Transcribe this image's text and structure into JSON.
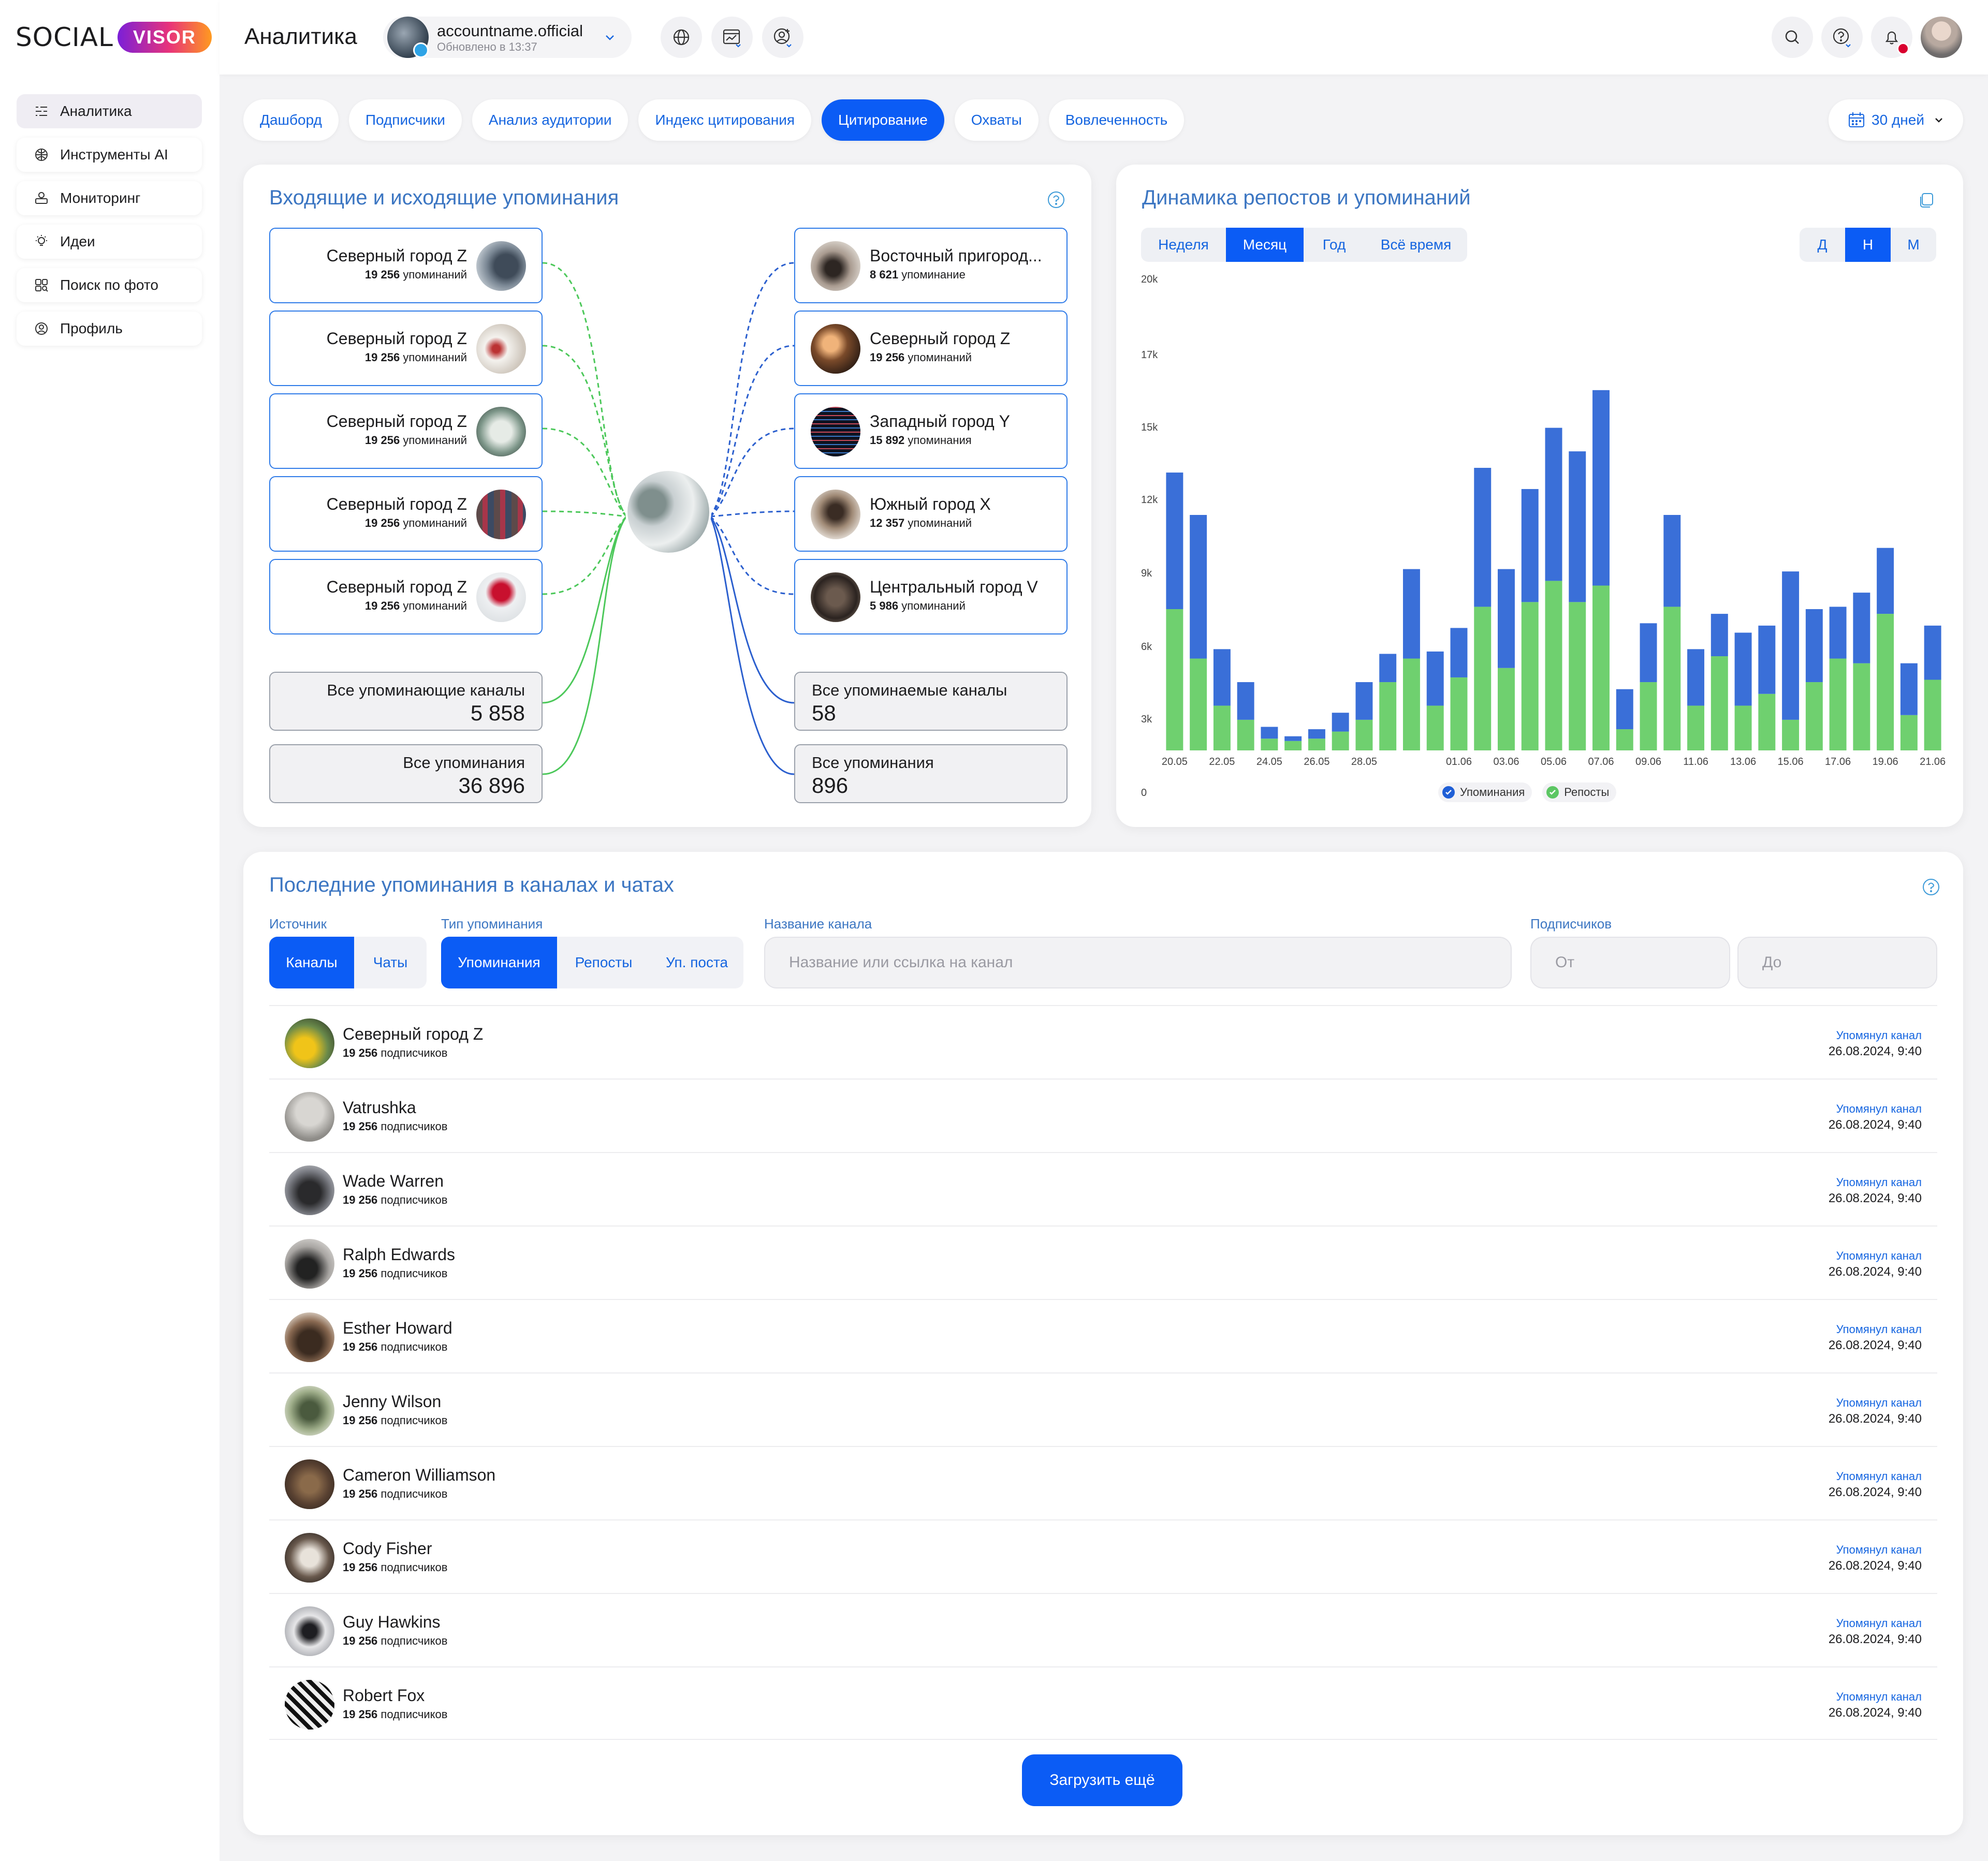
{
  "brand": {
    "social": "SOCIAL",
    "visor": "VISOR"
  },
  "sidebar": {
    "items": [
      {
        "label": "Аналитика",
        "icon": "analytics-icon",
        "active": true
      },
      {
        "label": "Инструменты AI",
        "icon": "ai-tools-icon",
        "active": false
      },
      {
        "label": "Мониторинг",
        "icon": "monitoring-icon",
        "active": false
      },
      {
        "label": "Идеи",
        "icon": "lightbulb-icon",
        "active": false
      },
      {
        "label": "Поиск по фото",
        "icon": "photo-search-icon",
        "active": false
      },
      {
        "label": "Профиль",
        "icon": "profile-icon",
        "active": false
      }
    ]
  },
  "header": {
    "title": "Аналитика",
    "account": {
      "name": "accountname.official",
      "updated": "Обновлено в 13:37"
    }
  },
  "tabs": [
    "Дашборд",
    "Подписчики",
    "Анализ аудитории",
    "Индекс цитирования",
    "Цитирование",
    "Охваты",
    "Вовлеченность"
  ],
  "active_tab": "Цитирование",
  "period": "30 дней",
  "mentions_map": {
    "title": "Входящие и исходящие упоминания",
    "incoming": [
      {
        "name": "Северный город Z",
        "count": "19 256",
        "unit": "упоминаний"
      },
      {
        "name": "Северный город Z",
        "count": "19 256",
        "unit": "упоминаний"
      },
      {
        "name": "Северный город Z",
        "count": "19 256",
        "unit": "упоминаний"
      },
      {
        "name": "Северный город Z",
        "count": "19 256",
        "unit": "упоминаний"
      },
      {
        "name": "Северный город Z",
        "count": "19 256",
        "unit": "упоминаний"
      }
    ],
    "outgoing": [
      {
        "name": "Восточный пригород...",
        "count": "8 621",
        "unit": "упоминание"
      },
      {
        "name": "Северный город Z",
        "count": "19 256",
        "unit": "упоминаний"
      },
      {
        "name": "Западный город Y",
        "count": "15 892",
        "unit": "упоминания"
      },
      {
        "name": "Южный город X",
        "count": "12 357",
        "unit": "упоминаний"
      },
      {
        "name": "Центральный город V",
        "count": "5 986",
        "unit": "упоминаний"
      }
    ],
    "totals_left": [
      {
        "label": "Все упоминающие каналы",
        "value": "5 858"
      },
      {
        "label": "Все упоминания",
        "value": "36 896"
      }
    ],
    "totals_right": [
      {
        "label": "Все упоминаемые каналы",
        "value": "58"
      },
      {
        "label": "Все упоминания",
        "value": "896"
      }
    ],
    "colors": {
      "incoming": "#4cc85a",
      "outgoing": "#2b5fce"
    }
  },
  "dynamics": {
    "title": "Динамика репостов и упоминаний",
    "ranges": [
      "Неделя",
      "Месяц",
      "Год",
      "Всё время"
    ],
    "active_range": "Месяц",
    "granularity": [
      "Д",
      "Н",
      "М"
    ],
    "active_granularity": "Н"
  },
  "chart_data": {
    "type": "bar",
    "stacked": true,
    "y_ticks": [
      "0",
      "3k",
      "6k",
      "9k",
      "12k",
      "15k",
      "17k",
      "20k"
    ],
    "ylim": [
      0,
      20000
    ],
    "x_tick_labels": [
      "20.05",
      "22.05",
      "24.05",
      "26.05",
      "28.05",
      "01.06",
      "03.06",
      "05.06",
      "07.06",
      "09.06",
      "11.06",
      "13.06",
      "15.06",
      "17.06",
      "19.06",
      "21.06"
    ],
    "categories": [
      "20.05",
      "21.05",
      "22.05",
      "23.05",
      "24.05",
      "25.05",
      "26.05",
      "27.05",
      "28.05",
      "29.05",
      "30.05",
      "31.05",
      "01.06",
      "02.06",
      "03.06",
      "04.06",
      "05.06",
      "06.06",
      "07.06",
      "08.06",
      "09.06",
      "10.06",
      "11.06",
      "12.06",
      "13.06",
      "14.06",
      "15.06",
      "16.06",
      "17.06",
      "18.06",
      "19.06",
      "20.06",
      "21.06"
    ],
    "series": [
      {
        "name": "Репосты",
        "color": "#6fd06f",
        "values": [
          6000,
          3900,
          1900,
          1300,
          500,
          400,
          500,
          800,
          1300,
          2900,
          3900,
          1900,
          3100,
          6100,
          3500,
          6300,
          7200,
          6300,
          7000,
          900,
          2900,
          6100,
          1900,
          4000,
          1900,
          2400,
          1300,
          2900,
          3900,
          3700,
          5800,
          1500,
          3000
        ]
      },
      {
        "name": "Упоминания",
        "color": "#3a6fd8",
        "values": [
          5800,
          6100,
          2400,
          1600,
          500,
          200,
          400,
          800,
          1600,
          1200,
          3800,
          2300,
          2100,
          5900,
          4200,
          4800,
          6500,
          6400,
          8300,
          1700,
          2500,
          3900,
          2400,
          1800,
          3100,
          2900,
          6300,
          3100,
          2200,
          3000,
          2800,
          2200,
          2300
        ]
      }
    ]
  },
  "recent": {
    "title": "Последние упоминания в каналах и чатах",
    "filters": {
      "source_label": "Источник",
      "source_options": [
        "Каналы",
        "Чаты"
      ],
      "source_active": "Каналы",
      "type_label": "Тип упоминания",
      "type_options": [
        "Упоминания",
        "Репосты",
        "Уп. поста"
      ],
      "type_active": "Упоминания",
      "channel_label": "Название канала",
      "channel_placeholder": "Название или ссылка на канал",
      "subs_label": "Подписчиков",
      "from_placeholder": "От",
      "to_placeholder": "До"
    },
    "rows": [
      {
        "name": "Северный город Z",
        "subs": "19 256",
        "unit": "подписчиков",
        "type": "Упомянул канал",
        "date": "26.08.2024, 9:40"
      },
      {
        "name": "Vatrushka",
        "subs": "19 256",
        "unit": "подписчиков",
        "type": "Упомянул канал",
        "date": "26.08.2024, 9:40"
      },
      {
        "name": "Wade Warren",
        "subs": "19 256",
        "unit": "подписчиков",
        "type": "Упомянул канал",
        "date": "26.08.2024, 9:40"
      },
      {
        "name": "Ralph Edwards",
        "subs": "19 256",
        "unit": "подписчиков",
        "type": "Упомянул канал",
        "date": "26.08.2024, 9:40"
      },
      {
        "name": "Esther Howard",
        "subs": "19 256",
        "unit": "подписчиков",
        "type": "Упомянул канал",
        "date": "26.08.2024, 9:40"
      },
      {
        "name": "Jenny Wilson",
        "subs": "19 256",
        "unit": "подписчиков",
        "type": "Упомянул канал",
        "date": "26.08.2024, 9:40"
      },
      {
        "name": "Cameron Williamson",
        "subs": "19 256",
        "unit": "подписчиков",
        "type": "Упомянул канал",
        "date": "26.08.2024, 9:40"
      },
      {
        "name": "Cody Fisher",
        "subs": "19 256",
        "unit": "подписчиков",
        "type": "Упомянул канал",
        "date": "26.08.2024, 9:40"
      },
      {
        "name": "Guy Hawkins",
        "subs": "19 256",
        "unit": "подписчиков",
        "type": "Упомянул канал",
        "date": "26.08.2024, 9:40"
      },
      {
        "name": "Robert Fox",
        "subs": "19 256",
        "unit": "подписчиков",
        "type": "Упомянул канал",
        "date": "26.08.2024, 9:40"
      }
    ],
    "load_more": "Загрузить ещё"
  }
}
